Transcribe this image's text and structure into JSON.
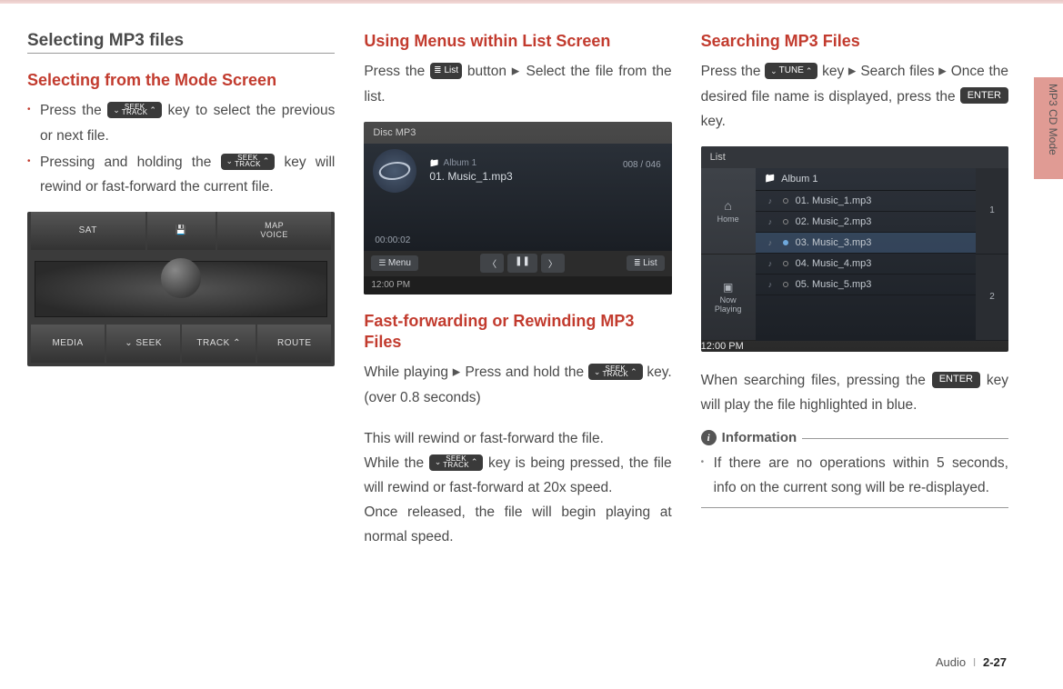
{
  "side_tab": "",
  "side_text": "MP3 CD Mode",
  "col1": {
    "title": "Selecting MP3 files",
    "heading": "Selecting from the Mode Screen",
    "bullets": [
      {
        "pre": "Press the ",
        "key": "seek",
        "post": " key to select the previous or next file."
      },
      {
        "pre": "Pressing and holding the ",
        "key": "seek",
        "post": " key will rewind or fast-forward the current file."
      }
    ],
    "panel_buttons": [
      "SAT",
      "",
      "MAP\nVOICE",
      "MEDIA",
      "⌄  SEEK",
      "TRACK  ⌃",
      "ROUTE"
    ]
  },
  "col2": {
    "h1": "Using Menus within List Screen",
    "p1a": "Press the ",
    "list_key": "List",
    "p1b": " button ",
    "p1c": " Select the file from the list.",
    "shot": {
      "top": "Disc  MP3",
      "album": "Album 1",
      "track": "01. Music_1.mp3",
      "counter": "008 / 046",
      "elapsed": "00:00:02",
      "menu": "Menu",
      "listb": "List",
      "time": "12:00 PM"
    },
    "h2": "Fast-forwarding or Rewinding MP3 Files",
    "p2a": "While playing ",
    "p2b": "Press and hold the ",
    "p2c": " key. (over 0.8 seconds)",
    "p3": "This will rewind or fast-forward the file.",
    "p4a": "While the ",
    "p4b": " key is being pressed, the file will rewind or fast-forward at 20x speed.",
    "p5": "Once released, the file will begin playing at normal speed."
  },
  "col3": {
    "h1": "Searching MP3 Files",
    "p1a": "Press the ",
    "tune_key": "TUNE",
    "p1b": " key ",
    "p1c": " Search files ",
    "p1d": " Once the desired file name is displayed, press the ",
    "enter_key": "ENTER",
    "p1e": " key.",
    "list": {
      "top": "List",
      "side": [
        "Home",
        "Now\nPlaying"
      ],
      "album": "Album 1",
      "rows": [
        "01. Music_1.mp3",
        "02. Music_2.mp3",
        "03. Music_3.mp3",
        "04. Music_4.mp3",
        "05. Music_5.mp3"
      ],
      "page": [
        "1",
        "2"
      ],
      "time": "12:00 PM"
    },
    "p2a": "When searching files, pressing the ",
    "p2b": " key will play the file highlighted in blue.",
    "info_label": "Information",
    "info_bullets": [
      "If there are no operations within 5 seconds, info on the current song will be re-displayed."
    ]
  },
  "footer": {
    "section": "Audio",
    "page": "2-27"
  }
}
